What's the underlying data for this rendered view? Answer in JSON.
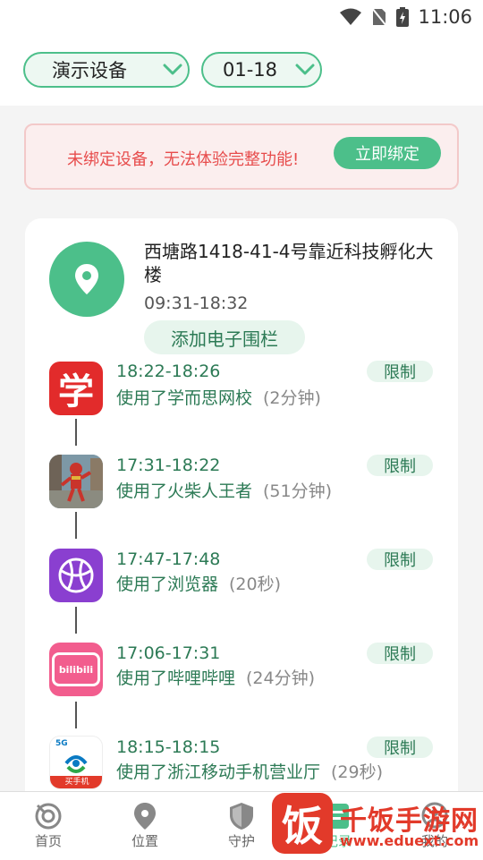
{
  "status_bar": {
    "time": "11:06"
  },
  "filters": {
    "device": "演示设备",
    "date": "01-18"
  },
  "alert": {
    "message": "未绑定设备，无法体验完整功能!",
    "button": "立即绑定"
  },
  "location": {
    "address": "西塘路1418-41-4号靠近科技孵化大楼",
    "time_range": "09:31-18:32",
    "fence_button": "添加电子围栏"
  },
  "records": [
    {
      "time": "18:22-18:26",
      "desc": "使用了学而思网校",
      "duration": "(2分钟)",
      "limit": "限制",
      "icon": "xueersi-app-icon"
    },
    {
      "time": "17:31-18:22",
      "desc": "使用了火柴人王者",
      "duration": "(51分钟)",
      "limit": "限制",
      "icon": "stickman-game-app-icon"
    },
    {
      "time": "17:47-17:48",
      "desc": "使用了浏览器",
      "duration": "(20秒)",
      "limit": "限制",
      "icon": "browser-app-icon"
    },
    {
      "time": "17:06-17:31",
      "desc": "使用了哔哩哔哩",
      "duration": "(24分钟)",
      "limit": "限制",
      "icon": "bilibili-app-icon"
    },
    {
      "time": "18:15-18:15",
      "desc": "使用了浙江移动手机营业厅",
      "duration": "(29秒)",
      "limit": "限制",
      "icon": "china-mobile-app-icon"
    }
  ],
  "icon_texts": {
    "xueersi": "学",
    "bilibili": "bilibili",
    "mobile_banner": "买手机",
    "mobile_5g": "5G"
  },
  "tabs": [
    {
      "label": "首页",
      "icon": "home-icon"
    },
    {
      "label": "位置",
      "icon": "location-icon"
    },
    {
      "label": "守护",
      "icon": "shield-icon"
    },
    {
      "label": "记录",
      "icon": "record-icon"
    },
    {
      "label": "我的",
      "icon": "profile-icon"
    }
  ],
  "watermark": {
    "glyph": "饭",
    "name": "千饭手游网",
    "url": "www.eduext.com"
  },
  "colors": {
    "accent": "#4cbf8a",
    "accent_text": "#2c7a55",
    "alert_text": "#e74c4c",
    "watermark": "#e23a2a"
  }
}
